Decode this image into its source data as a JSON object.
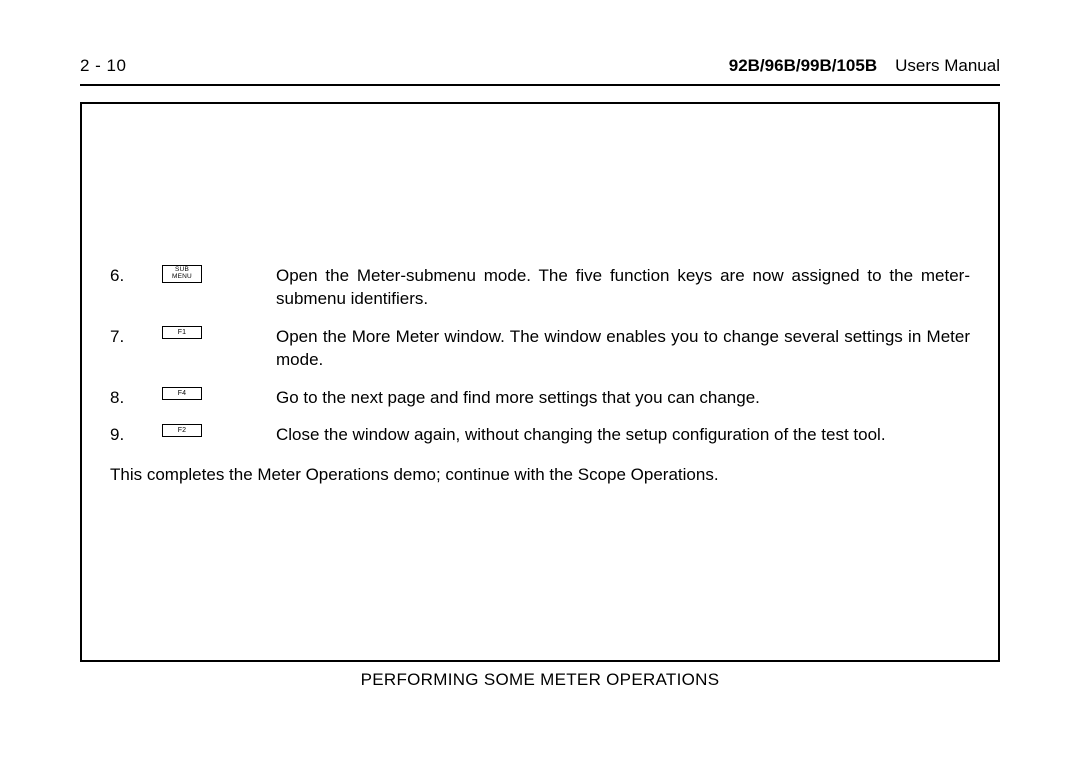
{
  "header": {
    "page_number": "2 - 10",
    "model": "92B/96B/99B/105B",
    "title": "Users Manual"
  },
  "steps": [
    {
      "num": "6.",
      "key_lines": [
        "SUB",
        "MENU"
      ],
      "key_style": "double",
      "text": "Open the Meter-submenu mode. The five function keys are now assigned to the meter-submenu identifiers.",
      "justify": true
    },
    {
      "num": "7.",
      "key_lines": [
        "F1"
      ],
      "key_style": "single",
      "text": "Open the More Meter window. The window enables you to change several settings in Meter mode.",
      "justify": true
    },
    {
      "num": "8.",
      "key_lines": [
        "F4"
      ],
      "key_style": "single",
      "text": "Go to the next page and find more settings that you can change.",
      "justify": false
    },
    {
      "num": "9.",
      "key_lines": [
        "F2"
      ],
      "key_style": "single",
      "text": "Close the window again, without changing the setup configuration of the test tool.",
      "justify": false
    }
  ],
  "closing": "This completes the Meter Operations demo; continue with the Scope Operations.",
  "footer": "PERFORMING SOME METER OPERATIONS"
}
